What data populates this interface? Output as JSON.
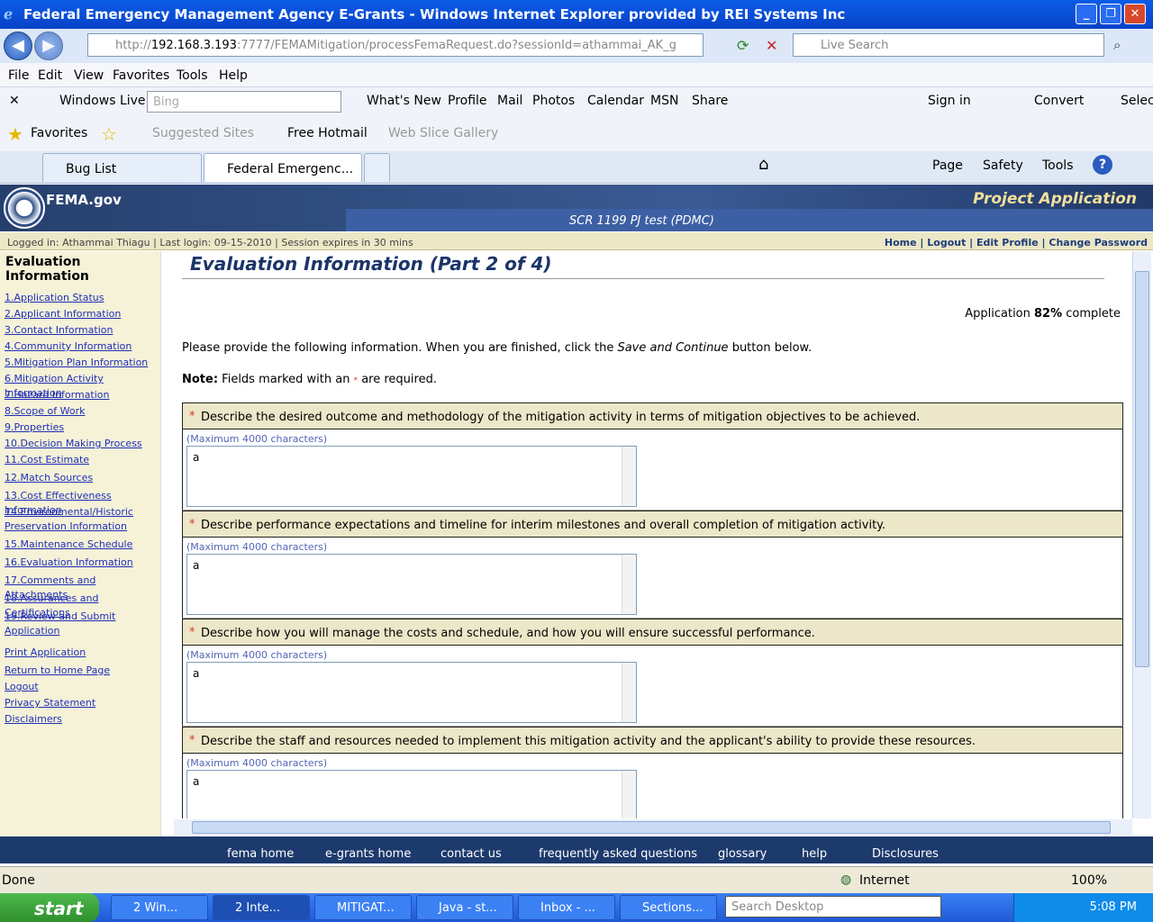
{
  "window": {
    "title": "Federal Emergency Management Agency E-Grants - Windows Internet Explorer provided by REI Systems Inc"
  },
  "address": {
    "prefix": "http://",
    "host": "192.168.3.193",
    "rest": ":7777/FEMAMitigation/processFemaRequest.do?sessionId=athammai_AK_g",
    "live_search_placeholder": "Live Search"
  },
  "menu": [
    "File",
    "Edit",
    "View",
    "Favorites",
    "Tools",
    "Help"
  ],
  "livebar": {
    "windows_live": "Windows Live",
    "bing": "Bing",
    "items": [
      "What's New",
      "Profile",
      "Mail",
      "Photos",
      "Calendar",
      "MSN",
      "Share"
    ],
    "sign_in": "Sign in",
    "convert": "Convert",
    "select": "Selec"
  },
  "favbar": {
    "favorites": "Favorites",
    "suggested": "Suggested Sites",
    "hotmail": "Free Hotmail",
    "webslice": "Web Slice Gallery"
  },
  "tabs": [
    "Bug List",
    "Federal Emergenc..."
  ],
  "cmdbar": [
    "Page",
    "Safety",
    "Tools"
  ],
  "fema": {
    "logo": "FEMA.gov",
    "project": "Project Application",
    "scr": "SCR 1199 PJ test (PDMC)"
  },
  "loginbar": {
    "left": "Logged in: Athammai Thiagu  |  Last login: 09-15-2010  |  Session expires in 30 mins",
    "right": "Home | Logout | Edit Profile | Change Password"
  },
  "leftnav": {
    "heading": "Evaluation Information",
    "links": [
      "1.Application Status",
      "2.Applicant Information",
      "3.Contact Information",
      "4.Community Information",
      "5.Mitigation Plan Information",
      "6.Mitigation Activity Information",
      "7.Hazard Information",
      "8.Scope of Work",
      "9.Properties",
      "10.Decision Making Process",
      "11.Cost Estimate",
      "12.Match Sources",
      "13.Cost Effectiveness Information",
      "14.Environmental/Historic",
      "Preservation Information",
      "15.Maintenance Schedule",
      "16.Evaluation Information",
      "17.Comments and Attachments",
      "18.Assurances and Certifications",
      "19.Review and Submit Application"
    ],
    "extra": [
      "Print Application",
      "Return to Home Page",
      "Logout",
      "Privacy Statement",
      "Disclaimers"
    ]
  },
  "main": {
    "title": "Evaluation Information (Part 2 of 4)",
    "pct_pre": "Application ",
    "pct": "82%",
    "pct_post": " complete",
    "instr_pre": "Please provide the following information. When you are finished, click the ",
    "instr_em": "Save and Continue",
    "instr_post": " button below.",
    "note_b": "Note:",
    "note_pre": " Fields marked with an ",
    "note_star": "*",
    "note_post": " are required.",
    "questions": [
      {
        "q": "Describe the desired outcome and methodology of the mitigation activity in terms of mitigation objectives to be achieved.",
        "max": "(Maximum 4000 characters)",
        "value": "a"
      },
      {
        "q": "Describe performance expectations and timeline for interim milestones and overall completion of mitigation activity.",
        "max": "(Maximum 4000 characters)",
        "value": "a"
      },
      {
        "q": "Describe how you will manage the costs and schedule, and how you will ensure successful performance.",
        "max": "(Maximum 4000 characters)",
        "value": "a"
      },
      {
        "q": "Describe the staff and resources needed to implement this mitigation activity and the applicant's ability to provide these resources.",
        "max": "(Maximum 4000 characters)",
        "value": "a"
      }
    ]
  },
  "footer": [
    "fema home",
    "e-grants home",
    "contact us",
    "frequently asked questions",
    "glossary",
    "help",
    "Disclosures"
  ],
  "status": {
    "done": "Done",
    "zone": "Internet",
    "zoom": "100%"
  },
  "taskbar": {
    "start": "start",
    "tasks": [
      "2 Win...",
      "2 Inte...",
      "MITIGAT...",
      "Java - st...",
      "Inbox - ...",
      "Sections..."
    ],
    "search": "Search Desktop",
    "clock": "5:08 PM"
  }
}
